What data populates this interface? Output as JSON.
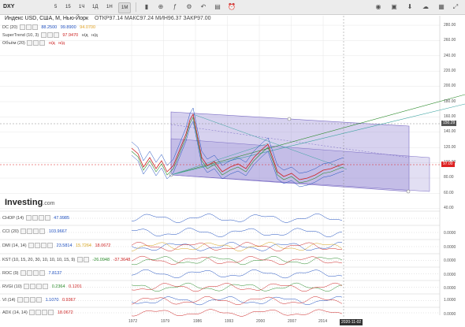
{
  "toolbar": {
    "symbol": "DXY",
    "timeframes": [
      "5",
      "15",
      "1Ч",
      "1Д",
      "1Н",
      "1М"
    ],
    "active_timeframe": "1М",
    "icons": [
      "compare-icon",
      "indicators-icon",
      "settings-icon",
      "fullscreen-icon",
      "camera-icon",
      "save-icon",
      "download-icon",
      "cloud-icon",
      "layout-icon"
    ]
  },
  "header": {
    "title": "Индекс USD, США, М, Нью-Йорк",
    "open_label": "ОТКР",
    "open": "97.14",
    "high_label": "МАКС",
    "high": "97.24",
    "low_label": "МИН",
    "low": "96.37",
    "close_label": "ЗАКР",
    "close": "97.00"
  },
  "overlays": [
    {
      "name": "DC (20)",
      "values": [
        "88.2500",
        "99.8900",
        "94.0700"
      ],
      "colors": [
        "#1e4fbf",
        "#1e4fbf",
        "#e0a020"
      ]
    },
    {
      "name": "SuperTrend (10, 3)",
      "values": [
        "97.9470",
        "н/д",
        "н/д"
      ],
      "colors": [
        "#cc2222",
        "#444",
        "#444"
      ]
    },
    {
      "name": "Объём (20)",
      "values": [
        "н/д",
        "н/д"
      ],
      "colors": [
        "#444",
        "#444"
      ]
    }
  ],
  "logo": {
    "brand": "Investing",
    "suffix": ".com"
  },
  "y_axis": [
    "280.00",
    "260.00",
    "240.00",
    "220.00",
    "200.00",
    "180.00",
    "160.00",
    "140.00",
    "120.00",
    "100.00",
    "80.00",
    "60.00",
    "40.00"
  ],
  "price_tags": {
    "upper": "150.29",
    "current": "97.00"
  },
  "x_axis": [
    "1972",
    "1979",
    "1986",
    "1993",
    "2000",
    "2007",
    "2014"
  ],
  "date_tag": "2020-11-02",
  "indicators": [
    {
      "name": "CHOP (14)",
      "values": [
        "47.9985"
      ],
      "colors": [
        "#1e4fbf"
      ],
      "axis": []
    },
    {
      "name": "CCI (20)",
      "values": [
        "103.9667"
      ],
      "colors": [
        "#1e4fbf"
      ],
      "axis": [
        "0.0000"
      ]
    },
    {
      "name": "DMI (14, 14)",
      "values": [
        "23.5814",
        "15.7264",
        "18.0672"
      ],
      "colors": [
        "#1e4fbf",
        "#d4a017",
        "#cc2222"
      ],
      "axis": [
        "0.0000"
      ]
    },
    {
      "name": "KST (10, 15, 20, 30, 10, 10, 10, 15, 9)",
      "values": [
        "-26.0948",
        "-37.3648"
      ],
      "colors": [
        "#2a8a2a",
        "#cc2222"
      ],
      "axis": [
        "0.0000"
      ]
    },
    {
      "name": "ROC (9)",
      "values": [
        "7.8137"
      ],
      "colors": [
        "#1e4fbf"
      ],
      "axis": [
        "0.0000"
      ]
    },
    {
      "name": "RVGI (10)",
      "values": [
        "0.2364",
        "0.1201"
      ],
      "colors": [
        "#2a8a2a",
        "#cc2222"
      ],
      "axis": [
        "0.0000"
      ]
    },
    {
      "name": "VI (14)",
      "values": [
        "1.1070",
        "0.9367"
      ],
      "colors": [
        "#1e4fbf",
        "#cc2222"
      ],
      "axis": [
        "1.0000"
      ]
    },
    {
      "name": "ADX (14, 14)",
      "values": [
        "18.0672"
      ],
      "colors": [
        "#cc2222"
      ],
      "axis": [
        "0.0000"
      ]
    }
  ],
  "colors": {
    "channel_fill": "#8d7fd0",
    "line_up": "#2a8a2a",
    "line_down": "#cc2222",
    "blue": "#1e4fbf",
    "grid": "#e6e6e6"
  }
}
